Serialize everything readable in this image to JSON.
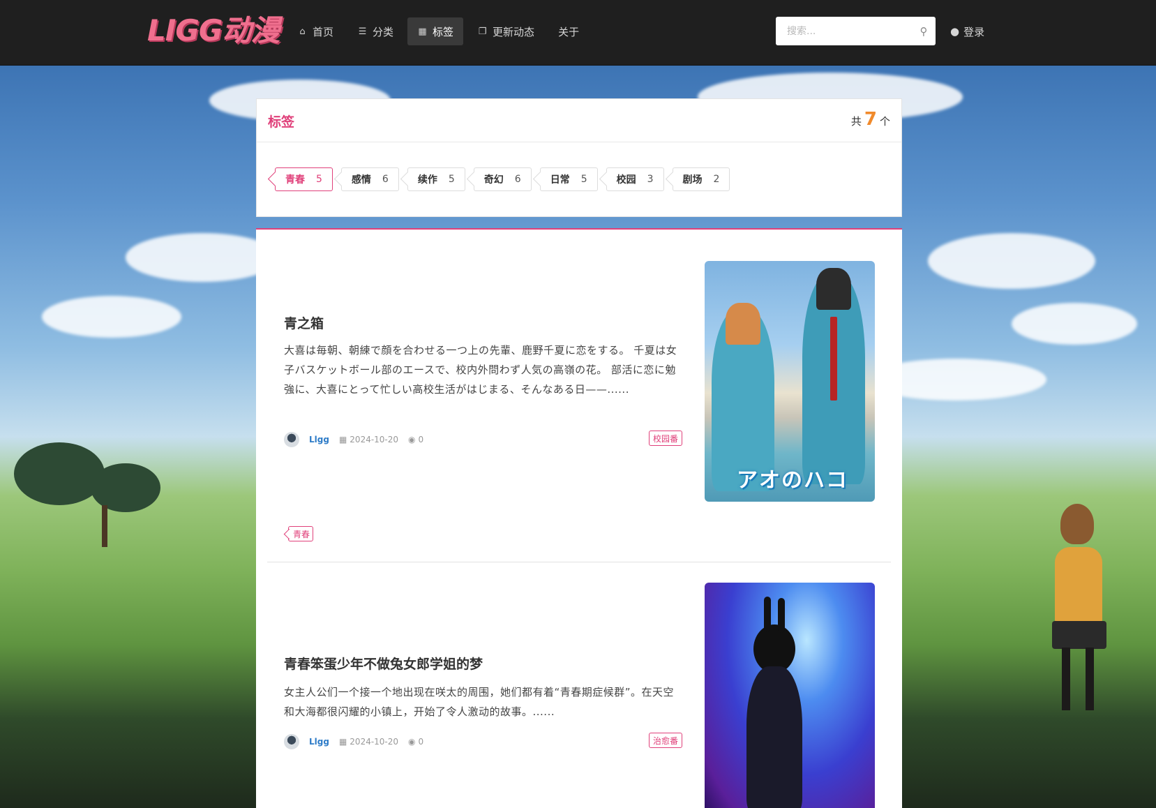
{
  "header": {
    "logo_text": "LIGG动漫",
    "nav": [
      {
        "label": "首页",
        "icon": "home-icon",
        "glyph": "⌂",
        "active": false
      },
      {
        "label": "分类",
        "icon": "list-icon",
        "glyph": "☰",
        "active": false
      },
      {
        "label": "标签",
        "icon": "film-icon",
        "glyph": "▦",
        "active": true
      },
      {
        "label": "更新动态",
        "icon": "copy-icon",
        "glyph": "❐",
        "active": false
      },
      {
        "label": "关于",
        "icon": "",
        "glyph": "",
        "active": false
      }
    ],
    "search_placeholder": "搜索...",
    "login_label": "登录"
  },
  "tag_panel": {
    "title": "标签",
    "count_prefix": "共",
    "count": "7",
    "count_suffix": "个",
    "tags": [
      {
        "name": "青春",
        "count": "5",
        "active": true
      },
      {
        "name": "感情",
        "count": "6",
        "active": false
      },
      {
        "name": "续作",
        "count": "5",
        "active": false
      },
      {
        "name": "奇幻",
        "count": "6",
        "active": false
      },
      {
        "name": "日常",
        "count": "5",
        "active": false
      },
      {
        "name": "校园",
        "count": "3",
        "active": false
      },
      {
        "name": "剧场",
        "count": "2",
        "active": false
      }
    ]
  },
  "posts": [
    {
      "title": "青之箱",
      "description": "大喜は毎朝、朝練で顔を合わせる一つ上の先輩、鹿野千夏に恋をする。 千夏は女子バスケットボール部のエースで、校内外問わず人気の高嶺の花。 部活に恋に勉強に、大喜にとって忙しい高校生活がはじまる、そんなある日——......",
      "author": "Llgg",
      "date": "2024-10-20",
      "views": "0",
      "category": "校园番",
      "cover_text": "アオのハコ",
      "tags": [
        "青春"
      ]
    },
    {
      "title": "青春笨蛋少年不做兔女郎学姐的梦",
      "description": "女主人公们一个接一个地出现在咲太的周围，她们都有着“青春期症候群”。在天空和大海都很闪耀的小镇上，开始了令人激动的故事。......",
      "author": "Llgg",
      "date": "2024-10-20",
      "views": "0",
      "category": "治愈番"
    }
  ],
  "colors": {
    "accent": "#e0407a",
    "count_orange": "#f08a2c",
    "author_blue": "#2e7cc8",
    "topbar": "#1f1f1f"
  }
}
